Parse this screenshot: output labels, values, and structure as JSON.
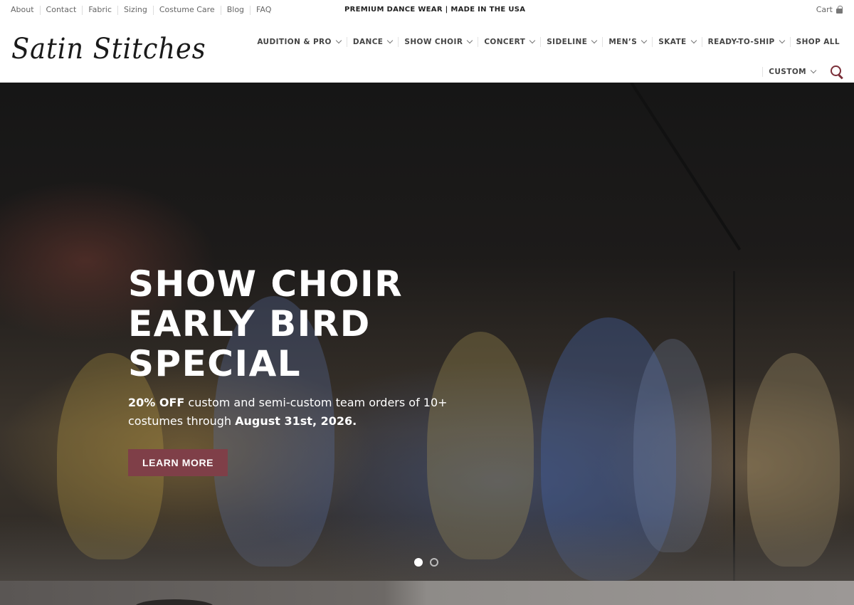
{
  "topbar": {
    "links": [
      "About",
      "Contact",
      "Fabric",
      "Sizing",
      "Costume Care",
      "Blog",
      "FAQ"
    ],
    "promo": "PREMIUM DANCE WEAR | MADE IN THE USA",
    "cart_label": "Cart"
  },
  "header": {
    "logo_text": "Satin Stitches",
    "nav": [
      {
        "label": "AUDITION & PRO",
        "dropdown": true
      },
      {
        "label": "DANCE",
        "dropdown": true
      },
      {
        "label": "SHOW CHOIR",
        "dropdown": true
      },
      {
        "label": "CONCERT",
        "dropdown": true
      },
      {
        "label": "SIDELINE",
        "dropdown": true
      },
      {
        "label": "MEN’S",
        "dropdown": true
      },
      {
        "label": "SKATE",
        "dropdown": true
      },
      {
        "label": "READY-TO-SHIP",
        "dropdown": true
      },
      {
        "label": "SHOP ALL",
        "dropdown": false
      }
    ],
    "nav_second_row": {
      "label": "CUSTOM",
      "dropdown": true
    }
  },
  "hero": {
    "title_lines": [
      "SHOW CHOIR",
      "EARLY BIRD",
      "SPECIAL"
    ],
    "sub_bold_1": "20% OFF",
    "sub_text_1": " custom and semi-custom team orders of 10+ costumes through ",
    "sub_bold_2": "August 31st, 2026.",
    "button_label": "LEARN MORE",
    "slide_count": 2,
    "active_slide": 1
  },
  "colors": {
    "accent": "#7f3f48",
    "search_icon": "#7a2e38",
    "text_dark": "#222222"
  }
}
